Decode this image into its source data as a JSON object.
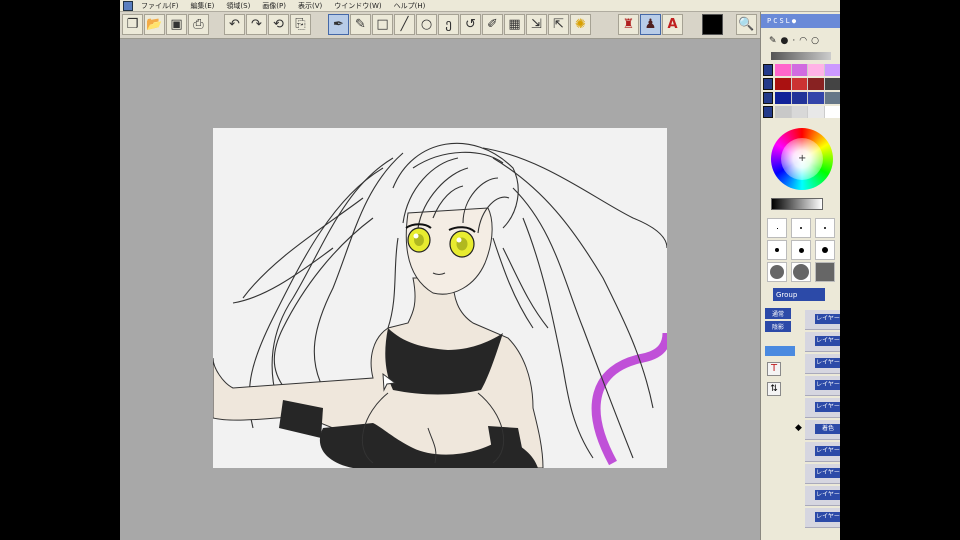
{
  "menu": {
    "items": [
      "ファイル(F)",
      "編集(E)",
      "領域(S)",
      "画像(P)",
      "表示(V)",
      "ウインドウ(W)",
      "ヘルプ(H)"
    ]
  },
  "toolbar": {
    "tools": [
      {
        "name": "new-file-icon",
        "glyph": "❐"
      },
      {
        "name": "open-folder-icon",
        "glyph": "📂"
      },
      {
        "name": "save-icon",
        "glyph": "▣"
      },
      {
        "name": "print-icon",
        "glyph": "⎙"
      },
      {
        "name": "undo-icon",
        "glyph": "↶"
      },
      {
        "name": "redo-icon",
        "glyph": "↷"
      },
      {
        "name": "rotate-view-icon",
        "glyph": "⟲"
      },
      {
        "name": "clipboard-icon",
        "glyph": "⎘"
      },
      {
        "name": "pen-tool-icon",
        "glyph": "✒"
      },
      {
        "name": "brush-tool-icon",
        "glyph": "✎"
      },
      {
        "name": "rectangle-tool-icon",
        "glyph": "□"
      },
      {
        "name": "line-tool-icon",
        "glyph": "╱"
      },
      {
        "name": "ellipse-tool-icon",
        "glyph": "○"
      },
      {
        "name": "lasso-tool-icon",
        "glyph": "ე"
      },
      {
        "name": "curve-tool-icon",
        "glyph": "↺"
      },
      {
        "name": "ruler-tool-icon",
        "glyph": "✐"
      },
      {
        "name": "grid-tool-icon",
        "glyph": "▦"
      },
      {
        "name": "transform-tool-icon",
        "glyph": "⇲"
      },
      {
        "name": "crop-tool-icon",
        "glyph": "⇱"
      },
      {
        "name": "sun-effect-icon",
        "glyph": "✺"
      },
      {
        "name": "stamp-tool-icon",
        "glyph": "♜"
      },
      {
        "name": "fill-tool-icon",
        "glyph": "♟"
      },
      {
        "name": "text-tool-icon",
        "glyph": "A"
      },
      {
        "name": "black-color-swatch",
        "glyph": ""
      },
      {
        "name": "zoom-icon",
        "glyph": "🔍"
      }
    ]
  },
  "right_panel": {
    "tab_labels": [
      "P",
      "C",
      "S",
      "L",
      "●"
    ],
    "color_select_label": "Group",
    "palette_rows": [
      [
        "#ff66cc",
        "#d16be0",
        "#ffb3e6",
        "#cc99ff"
      ],
      [
        "#aa1111",
        "#cc3333",
        "#882222",
        "#444444"
      ],
      [
        "#112299",
        "#223399",
        "#3344aa",
        "#667788"
      ],
      [
        "#c8c8c8",
        "#d8d8d8",
        "#e8e8e8",
        "#ffffff"
      ]
    ],
    "side_buttons": [
      "通常",
      "陰影"
    ],
    "layers": [
      "レイヤー",
      "レイヤー",
      "レイヤー",
      "レイヤー",
      "レイヤー",
      "着色",
      "レイヤー",
      "レイヤー",
      "レイヤー",
      "レイヤー"
    ]
  },
  "colors": {
    "app_bg": "#d4d0c8",
    "canvas_area": "#a8a8a8",
    "accent": "#2c4aa8",
    "skin": "#efe7dc",
    "outfit": "#262626",
    "eyes": "#e8ec30",
    "magenta_stroke": "#c050d8"
  }
}
